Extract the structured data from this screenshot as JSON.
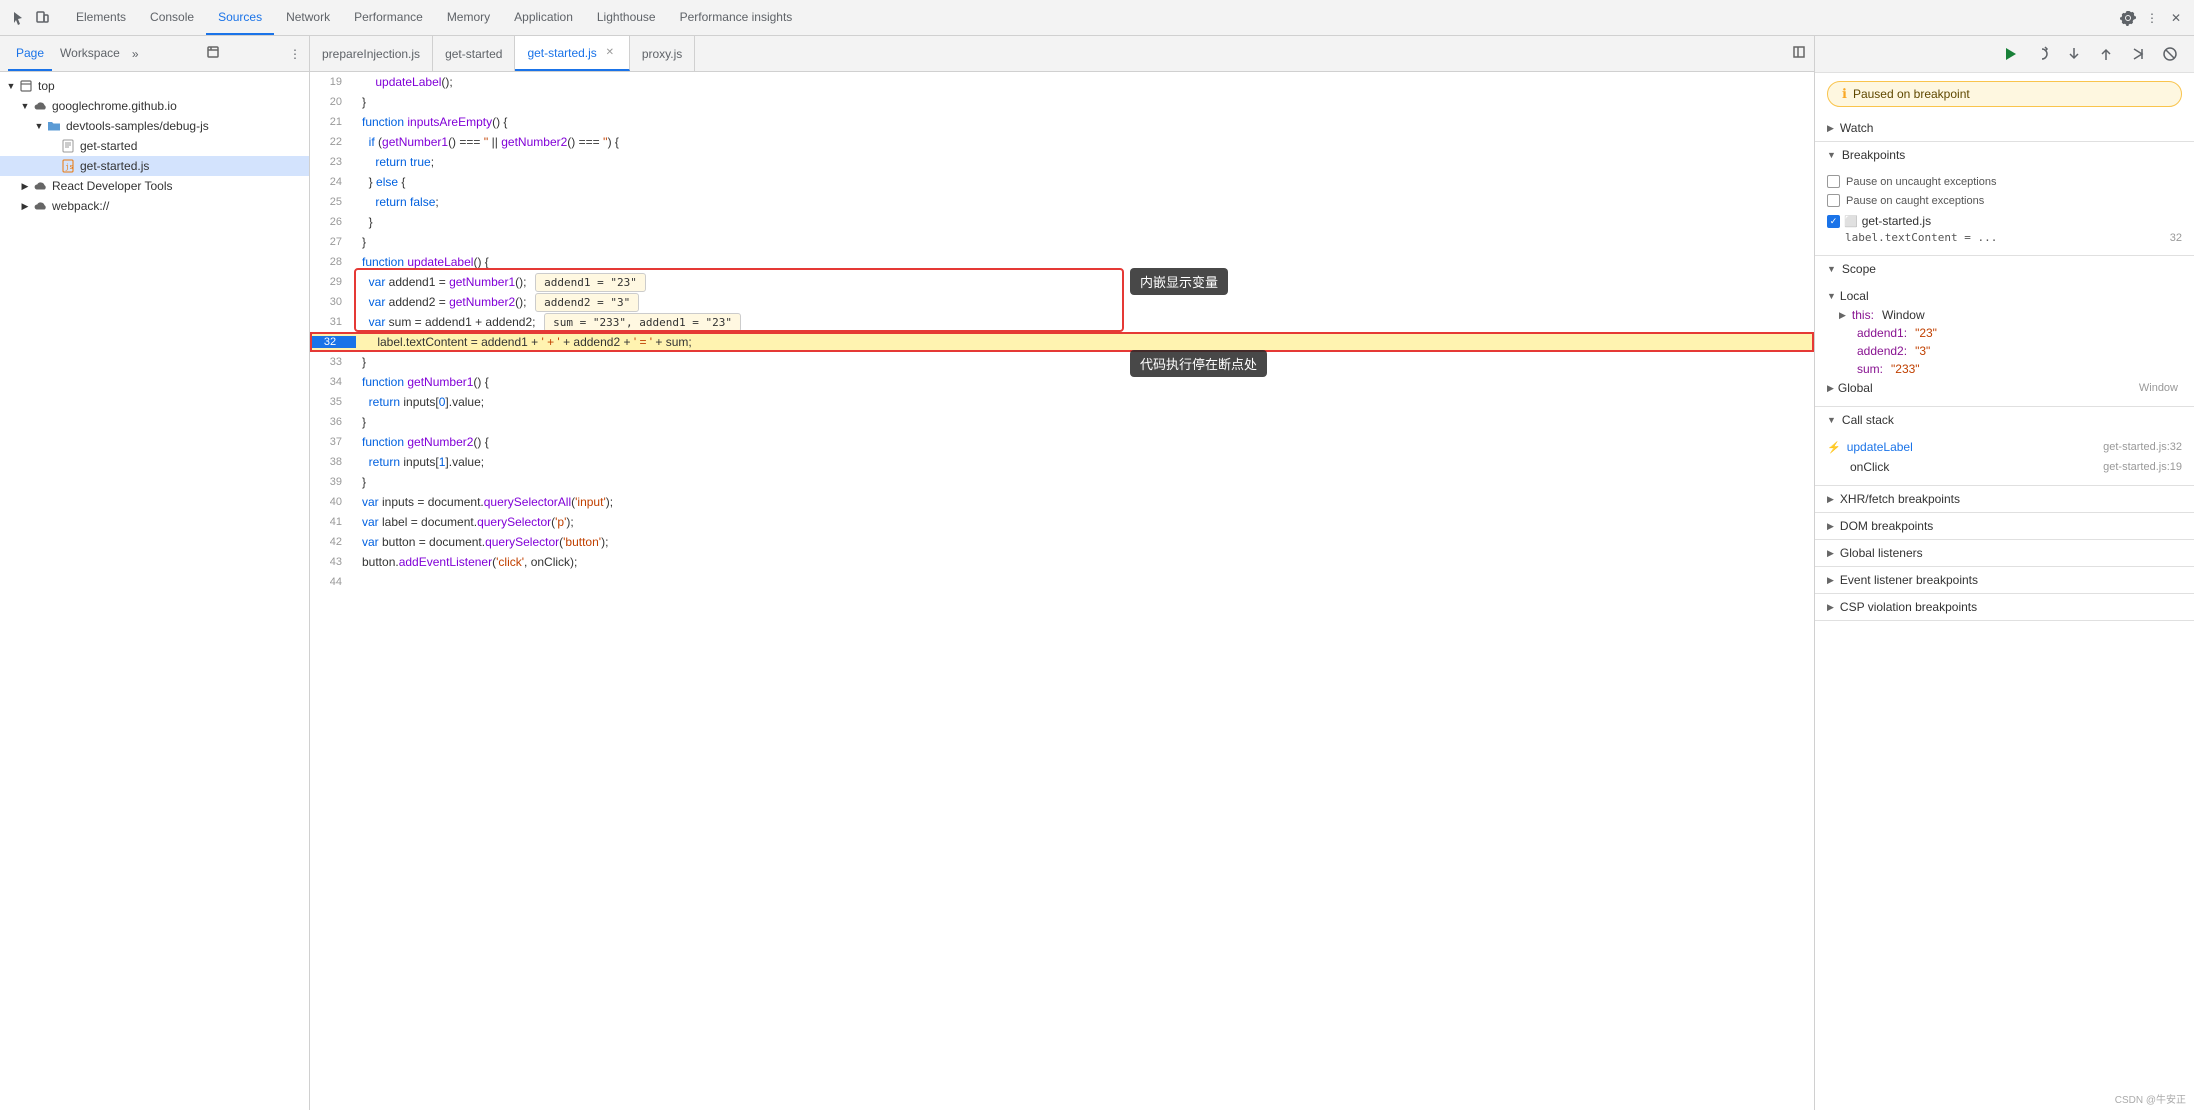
{
  "toolbar": {
    "icons": [
      "cursor-icon",
      "device-icon"
    ],
    "tabs": [
      {
        "label": "Elements",
        "active": false
      },
      {
        "label": "Console",
        "active": false
      },
      {
        "label": "Sources",
        "active": true
      },
      {
        "label": "Network",
        "active": false
      },
      {
        "label": "Performance",
        "active": false
      },
      {
        "label": "Memory",
        "active": false
      },
      {
        "label": "Application",
        "active": false
      },
      {
        "label": "Lighthouse",
        "active": false
      },
      {
        "label": "Performance insights",
        "active": false
      }
    ],
    "right_icons": [
      "settings-icon",
      "more-icon",
      "close-icon"
    ]
  },
  "left_panel": {
    "tabs": [
      {
        "label": "Page",
        "active": true
      },
      {
        "label": "Workspace",
        "active": false
      }
    ],
    "tree": [
      {
        "indent": 0,
        "icon": "chevron-down",
        "type": "frame",
        "label": "top"
      },
      {
        "indent": 1,
        "icon": "chevron-down",
        "type": "cloud",
        "label": "googlechrome.github.io"
      },
      {
        "indent": 2,
        "icon": "chevron-down",
        "type": "folder",
        "label": "devtools-samples/debug-js"
      },
      {
        "indent": 3,
        "icon": "file",
        "type": "file",
        "label": "get-started"
      },
      {
        "indent": 3,
        "icon": "file-js",
        "type": "file-js",
        "label": "get-started.js",
        "selected": true
      },
      {
        "indent": 1,
        "icon": "chevron-right",
        "type": "cloud",
        "label": "React Developer Tools"
      },
      {
        "indent": 1,
        "icon": "chevron-right",
        "type": "cloud",
        "label": "webpack://"
      }
    ]
  },
  "editor": {
    "tabs": [
      {
        "label": "prepareInjection.js",
        "active": false,
        "closable": false
      },
      {
        "label": "get-started",
        "active": false,
        "closable": false
      },
      {
        "label": "get-started.js",
        "active": true,
        "closable": true
      },
      {
        "label": "proxy.js",
        "active": false,
        "closable": false
      }
    ],
    "lines": [
      {
        "num": 19,
        "content": "    updateLabel();",
        "type": "normal"
      },
      {
        "num": 20,
        "content": "}",
        "type": "normal"
      },
      {
        "num": 21,
        "content": "function inputsAreEmpty() {",
        "type": "normal"
      },
      {
        "num": 22,
        "content": "  if (getNumber1() === '' || getNumber2() === '') {",
        "type": "normal"
      },
      {
        "num": 23,
        "content": "    return true;",
        "type": "normal"
      },
      {
        "num": 24,
        "content": "  } else {",
        "type": "normal"
      },
      {
        "num": 25,
        "content": "    return false;",
        "type": "normal"
      },
      {
        "num": 26,
        "content": "  }",
        "type": "normal"
      },
      {
        "num": 27,
        "content": "}",
        "type": "normal"
      },
      {
        "num": 28,
        "content": "function updateLabel() {",
        "type": "normal"
      },
      {
        "num": 29,
        "content": "  var addend1 = getNumber1();",
        "type": "has-inline-tooltip"
      },
      {
        "num": 30,
        "content": "  var addend2 = getNumber2();",
        "type": "has-inline-tooltip2"
      },
      {
        "num": 31,
        "content": "  var sum = addend1 + addend2; sum = \"233\", addend1 = \"23\"",
        "type": "has-inline-tooltip3"
      },
      {
        "num": 32,
        "content": "    label.textContent = addend1 + ' + ' + addend2 + ' = ' + sum;",
        "type": "active",
        "has_breakpoint": true
      },
      {
        "num": 33,
        "content": "}",
        "type": "normal"
      },
      {
        "num": 34,
        "content": "function getNumber1() {",
        "type": "normal"
      },
      {
        "num": 35,
        "content": "  return inputs[0].value;",
        "type": "normal"
      },
      {
        "num": 36,
        "content": "}",
        "type": "normal"
      },
      {
        "num": 37,
        "content": "function getNumber2() {",
        "type": "normal"
      },
      {
        "num": 38,
        "content": "  return inputs[1].value;",
        "type": "normal"
      },
      {
        "num": 39,
        "content": "}",
        "type": "normal"
      },
      {
        "num": 40,
        "content": "var inputs = document.querySelectorAll('input');",
        "type": "normal"
      },
      {
        "num": 41,
        "content": "var label = document.querySelector('p');",
        "type": "normal"
      },
      {
        "num": 42,
        "content": "var button = document.querySelector('button');",
        "type": "normal"
      },
      {
        "num": 43,
        "content": "button.addEventListener('click', onClick);",
        "type": "normal"
      },
      {
        "num": 44,
        "content": "",
        "type": "normal"
      }
    ],
    "tooltips": {
      "inline_vars": "内嵌显示变量",
      "breakpoint_stop": "代码执行停在断点处",
      "var29": "addend1 = \"23\"",
      "var30": "addend2 = \"3\"",
      "var31": "sum = \"233\", addend1 = \"23\""
    }
  },
  "right_panel": {
    "paused_label": "Paused on breakpoint",
    "debugger_buttons": [
      "resume-icon",
      "step-over-icon",
      "step-into-icon",
      "step-out-icon",
      "step-icon",
      "deactivate-icon"
    ],
    "sections": {
      "watch": {
        "label": "Watch",
        "expanded": true
      },
      "breakpoints": {
        "label": "Breakpoints",
        "expanded": true,
        "checkboxes": [
          {
            "label": "Pause on uncaught exceptions",
            "checked": false
          },
          {
            "label": "Pause on caught exceptions",
            "checked": false
          }
        ],
        "files": [
          {
            "icon": "js-icon",
            "name": "get-started.js",
            "items": [
              {
                "text": "label.textContent = ...",
                "line": "32"
              }
            ]
          }
        ]
      },
      "scope": {
        "label": "Scope",
        "expanded": true,
        "local": {
          "label": "Local",
          "items": [
            {
              "key": "▶ this:",
              "val": "Window"
            },
            {
              "key": "addend1:",
              "val": "\"23\""
            },
            {
              "key": "addend2:",
              "val": "\"3\""
            },
            {
              "key": "sum:",
              "val": "\"233\""
            }
          ]
        },
        "global": {
          "label": "Global",
          "val": "Window"
        }
      },
      "call_stack": {
        "label": "Call stack",
        "expanded": true,
        "items": [
          {
            "fn": "updateLabel",
            "loc": "get-started.js:32"
          },
          {
            "fn": "onClick",
            "loc": "get-started.js:19"
          }
        ]
      },
      "xhr_breakpoints": {
        "label": "XHR/fetch breakpoints"
      },
      "dom_breakpoints": {
        "label": "DOM breakpoints"
      },
      "global_listeners": {
        "label": "Global listeners"
      },
      "event_breakpoints": {
        "label": "Event listener breakpoints"
      },
      "csp_breakpoints": {
        "label": "CSP violation breakpoints"
      }
    }
  },
  "watermark": "CSDN @牛安正"
}
